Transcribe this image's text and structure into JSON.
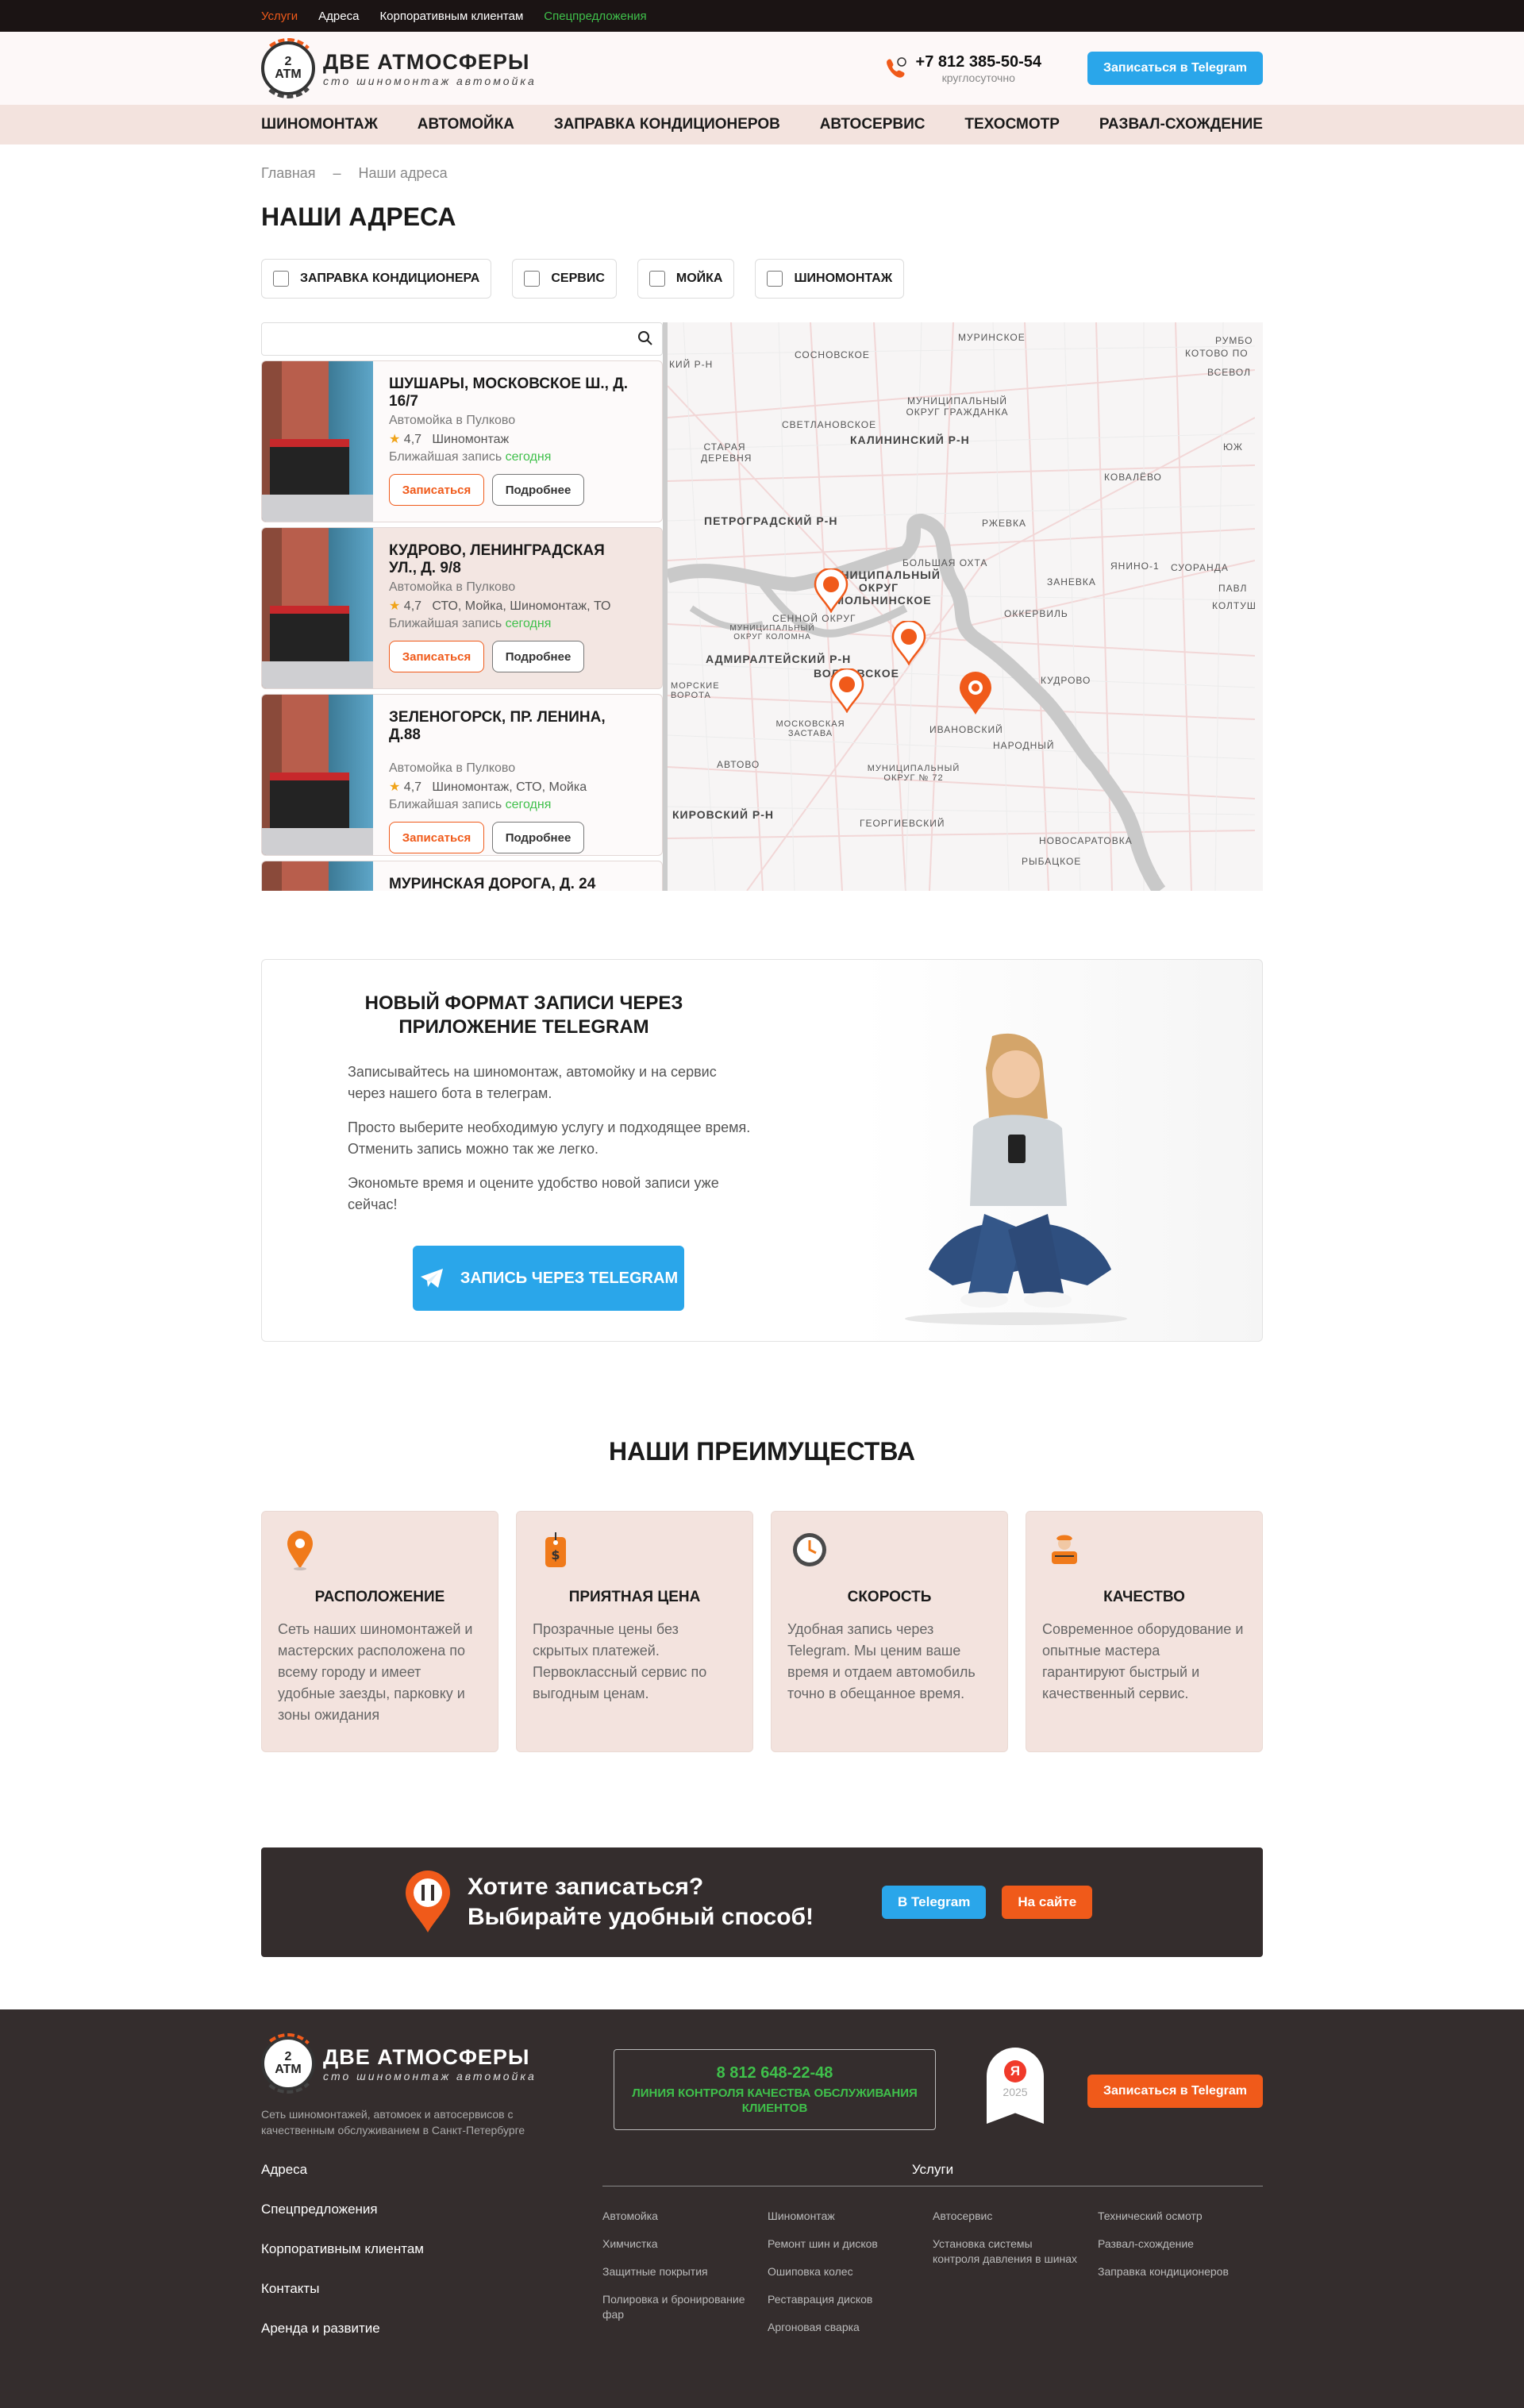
{
  "topbar": {
    "items": [
      "Услуги",
      "Адреса",
      "Корпоративным клиентам",
      "Спецпредложения"
    ]
  },
  "brand": {
    "mark_top": "2",
    "mark_bottom": "ATM",
    "name": "ДВЕ АТМОСФЕРЫ",
    "tagline": "сто шиномонтаж автомойка"
  },
  "header": {
    "phone": "+7 812 385-50-54",
    "phone_note": "круглосуточно",
    "cta": "Записаться в Telegram"
  },
  "nav": [
    "ШИНОМОНТАЖ",
    "АВТОМОЙКА",
    "ЗАПРАВКА КОНДИЦИОНЕРОВ",
    "АВТОСЕРВИС",
    "ТЕХОСМОТР",
    "РАЗВАЛ-СХОЖДЕНИЕ"
  ],
  "breadcrumb": {
    "home": "Главная",
    "sep": "–",
    "current": "Наши адреса"
  },
  "page_title": "НАШИ АДРЕСА",
  "filters": [
    "ЗАПРАВКА КОНДИЦИОНЕРА",
    "СЕРВИС",
    "МОЙКА",
    "ШИНОМОНТАЖ"
  ],
  "locations": [
    {
      "title": "ШУШАРЫ, МОСКОВСКОЕ Ш., Д. 16/7",
      "sub": "Автомойка в Пулково",
      "rating": "4,7",
      "services": "Шиномонтаж",
      "near": "Ближайшая запись",
      "when": "сегодня",
      "book": "Записаться",
      "more": "Подробнее"
    },
    {
      "title": "КУДРОВО, ЛЕНИНГРАДСКАЯ УЛ., Д. 9/8",
      "sub": "Автомойка в Пулково",
      "rating": "4,7",
      "services": "СТО, Мойка, Шиномонтаж, ТО",
      "near": "Ближайшая запись",
      "when": "сегодня",
      "book": "Записаться",
      "more": "Подробнее"
    },
    {
      "title": "ЗЕЛЕНОГОРСК, ПР. ЛЕНИНА, Д.88",
      "sub": "Автомойка в Пулково",
      "rating": "4,7",
      "services": "Шиномонтаж, СТО, Мойка",
      "near": "Ближайшая запись",
      "when": "сегодня",
      "book": "Записаться",
      "more": "Подробнее"
    },
    {
      "title": "МУРИНСКАЯ ДОРОГА, Д. 24"
    }
  ],
  "map_labels": [
    "МУРИНСКОЕ",
    "РУМБО",
    "КОТОВО ПО",
    "Всевол",
    "КИЙ Р-Н",
    "СОСНОВСКОЕ",
    "МУНИЦИПАЛЬНЫЙ ОКРУГ ГРАЖДАНКА",
    "СВЕТЛАНОВСКОЕ",
    "КАЛИНИНСКИЙ Р-Н",
    "СТАРАЯ ДЕРЕВНЯ",
    "Ковалёво",
    "ЮЖ",
    "ПЕТРОГРАДСКИЙ Р-Н",
    "РЖЕВКА",
    "БОЛЬШАЯ ОХТА",
    "МУНИЦИПАЛЬНЫЙ ОКРУГ СМОЛЬНИНСКОЕ",
    "Заневка",
    "Янино-1",
    "Суоранда",
    "Павл",
    "Колтуш",
    "СЕННОЙ ОКРУГ",
    "МУНИЦИПАЛЬНЫЙ ОКРУГ КОЛОМНА",
    "Оккервиль",
    "АДМИРАЛТЕЙСКИЙ Р-Н",
    "ВОЛКОВСКОЕ",
    "МОРСКИЕ ВОРОТА",
    "Кудрово",
    "МОСКОВСКАЯ ЗАСТАВА",
    "Ивановский",
    "НАРОДНЫЙ",
    "АВТОВО",
    "МУНИЦИПАЛЬНЫЙ ОКРУГ № 72",
    "КИРОВСКИЙ Р-Н",
    "ГЕОРГИЕВСКИЙ",
    "Новосаратовка",
    "РЫБАЦКОЕ"
  ],
  "promo": {
    "title": "НОВЫЙ ФОРМАТ ЗАПИСИ ЧЕРЕЗ ПРИЛОЖЕНИЕ TELEGRAM",
    "p1": "Записывайтесь на шиномонтаж, автомойку и на сервис через нашего бота в телеграм.",
    "p2": "Просто выберите необходимую услугу и подходящее время. Отменить запись можно так же легко.",
    "p3": "Экономьте время и оцените удобство новой записи уже сейчас!",
    "button": "ЗАПИСЬ ЧЕРЕЗ TELEGRAM"
  },
  "advantages": {
    "title": "НАШИ ПРЕИМУЩЕСТВА",
    "items": [
      {
        "icon": "location-pin-icon",
        "title": "РАСПОЛОЖЕНИЕ",
        "text": "Сеть наших шиномонтажей и мастерских расположена по всему городу и имеет удобные заезды, парковку и зоны ожидания"
      },
      {
        "icon": "price-tag-icon",
        "title": "ПРИЯТНАЯ ЦЕНА",
        "text": "Прозрачные цены без скрытых платежей. Первоклассный сервис по выгодным ценам."
      },
      {
        "icon": "clock-icon",
        "title": "СКОРОСТЬ",
        "text": "Удобная запись через Telegram. Мы ценим ваше время и отдаем автомобиль точно в обещанное время."
      },
      {
        "icon": "mechanic-icon",
        "title": "КАЧЕСТВО",
        "text": "Современное оборудование и опытные мастера гарантируют быстрый и качественный сервис."
      }
    ]
  },
  "cta": {
    "line1": "Хотите записаться?",
    "line2": "Выбирайте удобный способ!",
    "tg": "В Telegram",
    "site": "На сайте"
  },
  "footer": {
    "desc": "Сеть шиномонтажей, автомоек и автосервисов с качественным обслуживанием в Санкт-Петербурге",
    "hotline_number": "8 812 648-22-48",
    "hotline_label": "ЛИНИЯ КОНТРОЛЯ КАЧЕСТВА ОБСЛУЖИВАНИЯ КЛИЕНТОВ",
    "badge_letter": "Я",
    "badge_year": "2025",
    "cta": "Записаться в Telegram",
    "links": [
      "Адреса",
      "Спецпредложения",
      "Корпоративным клиентам",
      "Контакты",
      "Аренда и развитие"
    ],
    "services_title": "Услуги",
    "services": [
      [
        "Автомойка",
        "Химчистка",
        "Защитные покрытия",
        "Полировка и бронирование фар"
      ],
      [
        "Шиномонтаж",
        "Ремонт шин и дисков",
        "Ошиповка колес",
        "Реставрация дисков",
        "Аргоновая сварка"
      ],
      [
        "Автосервис",
        "Установка системы контроля давления в шинах"
      ],
      [
        "Технический осмотр",
        "Развал-схождение",
        "Заправка кондиционеров"
      ]
    ]
  },
  "colors": {
    "accent": "#f05a1a",
    "telegram": "#2aa6ea",
    "green": "#3fc04b",
    "dark": "#342d2d",
    "nav_bg": "#f3e3de"
  }
}
